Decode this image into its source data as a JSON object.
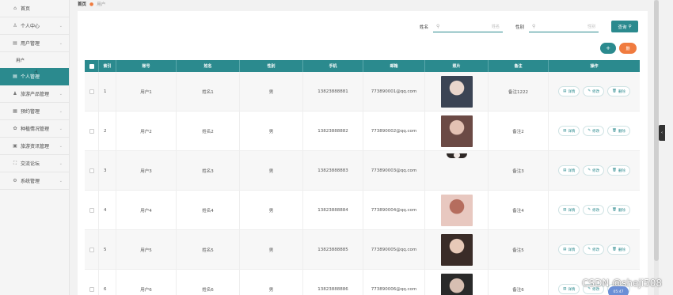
{
  "sidebar": {
    "items": [
      {
        "label": "首页",
        "icon": "home-icon",
        "glyph": "⌂",
        "has_chevron": false
      },
      {
        "label": "个人中心",
        "icon": "user-icon",
        "glyph": "♙",
        "has_chevron": true
      },
      {
        "label": "用户管理",
        "icon": "users-icon",
        "glyph": "▤",
        "has_chevron": true
      }
    ],
    "sub_label": "用户",
    "active_label": "个人管理",
    "items_after": [
      {
        "label": "旅游产品管理",
        "icon": "bag-icon",
        "glyph": "♟",
        "has_chevron": true
      },
      {
        "label": "预约管理",
        "icon": "calendar-icon",
        "glyph": "▦",
        "has_chevron": true
      },
      {
        "label": "种植情况管理",
        "icon": "settings-icon",
        "glyph": "✿",
        "has_chevron": true
      },
      {
        "label": "旅游资讯管理",
        "icon": "news-icon",
        "glyph": "▣",
        "has_chevron": true
      },
      {
        "label": "交流论坛",
        "icon": "forum-icon",
        "glyph": "⛶",
        "has_chevron": true
      },
      {
        "label": "系统管理",
        "icon": "gear-icon",
        "glyph": "⚙",
        "has_chevron": true
      }
    ]
  },
  "breadcrumb": {
    "home": "首页",
    "current": "用户"
  },
  "search": {
    "name_label": "姓名",
    "name_placeholder": "姓名",
    "sex_label": "性别",
    "sex_placeholder": "性别",
    "button_label": "查询"
  },
  "toolbar": {
    "add_label": "+",
    "delete_label": "删"
  },
  "table": {
    "headers": [
      "索引",
      "账号",
      "姓名",
      "性别",
      "手机",
      "邮箱",
      "照片",
      "备注",
      "操作"
    ],
    "rows": [
      {
        "index": "1",
        "account": "用户1",
        "name": "姓名1",
        "sex": "男",
        "phone": "13823888881",
        "email": "773890001@qq.com",
        "note": "备注1222",
        "photo_color": "#3b4454",
        "photo_accent": "#e9d6cc"
      },
      {
        "index": "2",
        "account": "用户2",
        "name": "姓名2",
        "sex": "男",
        "phone": "13823888882",
        "email": "773890002@qq.com",
        "note": "备注2",
        "photo_color": "#6b4a45",
        "photo_accent": "#e3c1b3"
      },
      {
        "index": "3",
        "account": "用户3",
        "name": "姓名3",
        "sex": "男",
        "phone": "13823888883",
        "email": "773890003@qq.com",
        "note": "备注3",
        "photo_color": "#2e2826",
        "photo_accent": "#f0e8e4"
      },
      {
        "index": "4",
        "account": "用户4",
        "name": "姓名4",
        "sex": "男",
        "phone": "13823888884",
        "email": "773890004@qq.com",
        "note": "备注4",
        "photo_color": "#e8c8c0",
        "photo_accent": "#b56d5e"
      },
      {
        "index": "5",
        "account": "用户5",
        "name": "姓名5",
        "sex": "男",
        "phone": "13823888885",
        "email": "773890005@qq.com",
        "note": "备注5",
        "photo_color": "#3a2c28",
        "photo_accent": "#e7c9b8"
      },
      {
        "index": "6",
        "account": "用户6",
        "name": "姓名6",
        "sex": "男",
        "phone": "13823888886",
        "email": "773890006@qq.com",
        "note": "备注6",
        "photo_color": "#2a2a2a",
        "photo_accent": "#d7bfb2"
      }
    ],
    "actions": {
      "detail": "详情",
      "edit": "修改",
      "delete": "删除"
    }
  },
  "watermark": "CSDN @sheji508",
  "badge": "05:47",
  "colors": {
    "primary": "#2b8a8e",
    "accent": "#f07b3f"
  }
}
